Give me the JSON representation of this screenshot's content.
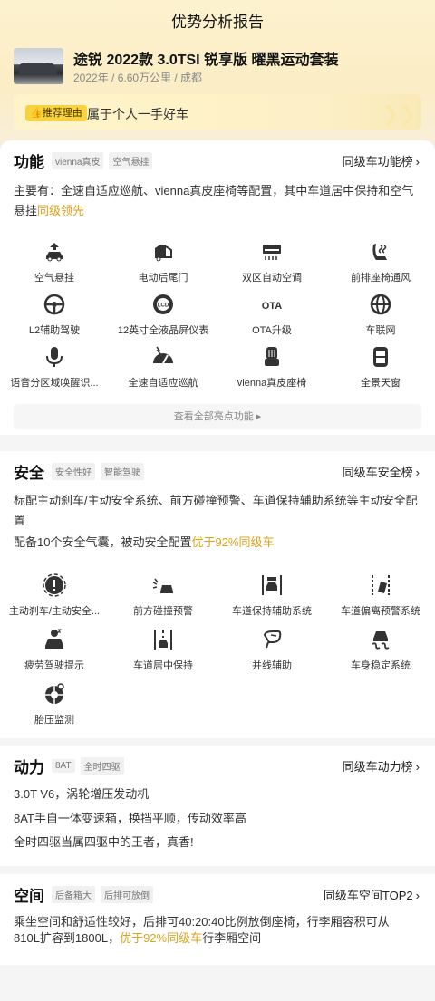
{
  "header": {
    "title": "优势分析报告"
  },
  "car": {
    "name": "途锐 2022款 3.0TSI 锐享版 曜黑运动套装",
    "meta": "2022年 / 6.60万公里 / 成都"
  },
  "reason": {
    "tag": "推荐理由",
    "text": "属于个人一手好车"
  },
  "function": {
    "title": "功能",
    "tags": [
      "vienna真皮",
      "空气悬挂"
    ],
    "rank": "同级车功能榜",
    "summary_pre": "主要有：全速自适应巡航、vienna真皮座椅等配置，其中车道居中保持和空气悬挂",
    "summary_hl": "同级领先",
    "items": [
      {
        "label": "空气悬挂",
        "icon": "air-suspension-icon"
      },
      {
        "label": "电动后尾门",
        "icon": "power-tailgate-icon"
      },
      {
        "label": "双区自动空调",
        "icon": "dual-zone-ac-icon"
      },
      {
        "label": "前排座椅通风",
        "icon": "seat-ventilation-icon"
      },
      {
        "label": "L2辅助驾驶",
        "icon": "l2-assist-icon"
      },
      {
        "label": "12英寸全液晶屏仪表",
        "icon": "lcd-cluster-icon"
      },
      {
        "label": "OTA升级",
        "icon": "ota-icon"
      },
      {
        "label": "车联网",
        "icon": "connected-car-icon"
      },
      {
        "label": "语音分区域唤醒识...",
        "icon": "voice-wake-icon"
      },
      {
        "label": "全速自适应巡航",
        "icon": "adaptive-cruise-icon"
      },
      {
        "label": "vienna真皮座椅",
        "icon": "leather-seat-icon"
      },
      {
        "label": "全景天窗",
        "icon": "panoramic-roof-icon"
      }
    ],
    "more": "查看全部亮点功能",
    "ota_text": "OTA",
    "lcd_text": "LCD"
  },
  "safety": {
    "title": "安全",
    "tags": [
      "安全性好",
      "智能驾驶"
    ],
    "rank": "同级车安全榜",
    "line1": "标配主动刹车/主动安全系统、前方碰撞预警、车道保持辅助系统等主动安全配置",
    "line2_pre": "配备10个安全气囊，被动安全配置",
    "line2_hl": "优于92%同级车",
    "items": [
      {
        "label": "主动刹车/主动安全...",
        "icon": "active-brake-icon"
      },
      {
        "label": "前方碰撞预警",
        "icon": "collision-warning-icon"
      },
      {
        "label": "车道保持辅助系统",
        "icon": "lane-keep-icon"
      },
      {
        "label": "车道偏离预警系统",
        "icon": "lane-departure-icon"
      },
      {
        "label": "疲劳驾驶提示",
        "icon": "fatigue-icon"
      },
      {
        "label": "车道居中保持",
        "icon": "lane-center-icon"
      },
      {
        "label": "并线辅助",
        "icon": "blind-spot-icon"
      },
      {
        "label": "车身稳定系统",
        "icon": "stability-icon"
      },
      {
        "label": "胎压监测",
        "icon": "tire-pressure-icon"
      }
    ]
  },
  "power": {
    "title": "动力",
    "tags": [
      "8AT",
      "全时四驱"
    ],
    "rank": "同级车动力榜",
    "lines": [
      "3.0T V6，涡轮增压发动机",
      "8AT手自一体变速箱，换挡平顺，传动效率高",
      "全时四驱当属四驱中的王者，真香!"
    ]
  },
  "space": {
    "title": "空间",
    "tags": [
      "后备箱大",
      "后排可放倒"
    ],
    "rank": "同级车空间TOP2",
    "line1": "乘坐空间和舒适性较好，后排可40:20:40比例放倒座椅，行李厢容积可从",
    "line2_pre": "810L扩容到1800L，",
    "line2_hl": "优于92%同级车",
    "line2_post": "行李厢空间"
  },
  "colors": {
    "accent": "#d9a21b",
    "tag_yellow": "#f9d33d",
    "icon": "#333333"
  }
}
